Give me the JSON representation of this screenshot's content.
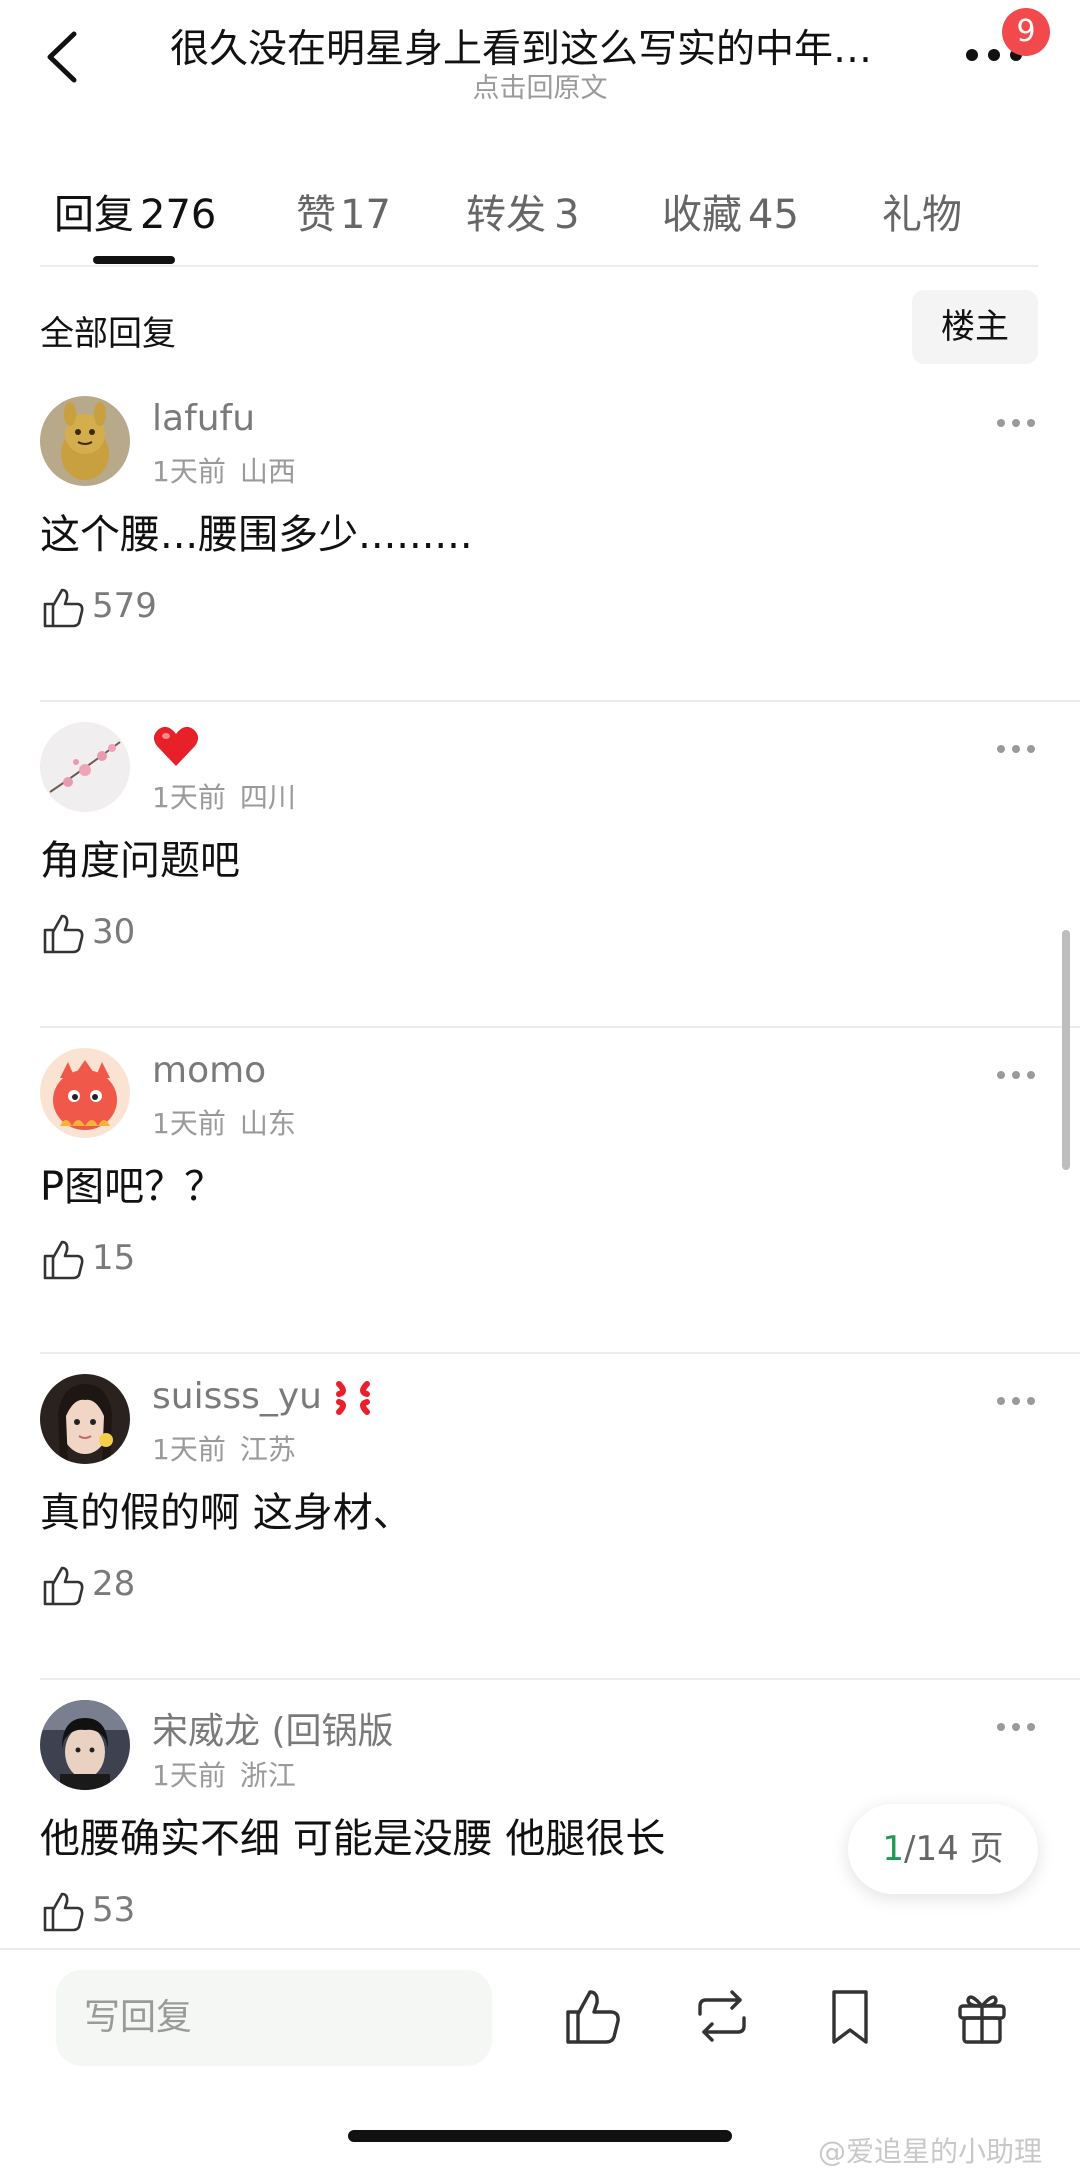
{
  "header": {
    "title": "很久没在明星身上看到这么写实的中年…",
    "subtitle": "点击回原文",
    "notification_count": "9"
  },
  "tabs": [
    {
      "label": "回复",
      "count": "276",
      "active": true
    },
    {
      "label": "赞",
      "count": "17",
      "active": false
    },
    {
      "label": "转发",
      "count": "3",
      "active": false
    },
    {
      "label": "收藏",
      "count": "45",
      "active": false
    },
    {
      "label": "礼物",
      "count": "",
      "active": false
    }
  ],
  "filter": {
    "label": "全部回复",
    "chip": "楼主"
  },
  "comments": [
    {
      "username": "lafufu",
      "time": "1天前",
      "region": "山西",
      "text": "这个腰...腰围多少.........",
      "likes": "579",
      "avatar_icon": "plush-toy-avatar"
    },
    {
      "username": "",
      "username_emoji": "heart-icon",
      "time": "1天前",
      "region": "四川",
      "text": "角度问题吧",
      "likes": "30",
      "avatar_icon": "plum-blossom-avatar"
    },
    {
      "username": "momo",
      "time": "1天前",
      "region": "山东",
      "text": "P图吧？？",
      "likes": "15",
      "avatar_icon": "red-monster-avatar"
    },
    {
      "username": "suisss_yu",
      "username_emoji": "anger-icon",
      "time": "1天前",
      "region": "江苏",
      "text": "真的假的啊 这身材、",
      "likes": "28",
      "avatar_icon": "girl-photo-avatar"
    },
    {
      "username": "宋威龙 (回锅版",
      "time": "1天前",
      "region": "浙江",
      "text": "他腰确实不细 可能是没腰 他腿很长",
      "likes": "53",
      "avatar_icon": "person-photo-avatar"
    }
  ],
  "pagination": {
    "current": "1",
    "rest": "/14 页"
  },
  "bottom_bar": {
    "reply_placeholder": "写回复"
  },
  "watermark": "@爱追星的小助理",
  "colors": {
    "accent_green": "#1e9a52",
    "badge_red": "#f2494c",
    "heart_red": "#e8202a"
  }
}
